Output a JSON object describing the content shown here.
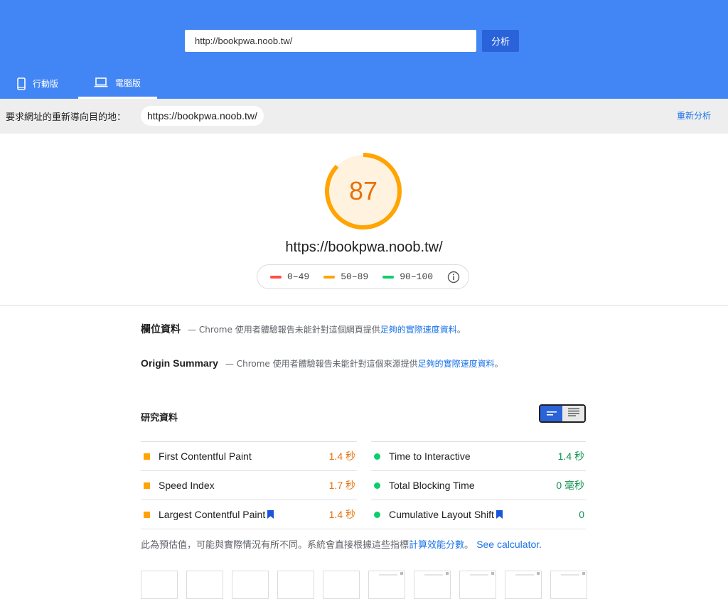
{
  "search": {
    "value": "http://bookpwa.noob.tw/",
    "button_label": "分析"
  },
  "tabs": [
    {
      "label": "行動版",
      "icon": "smartphone-icon",
      "active": false
    },
    {
      "label": "電腦版",
      "icon": "laptop-icon",
      "active": true
    }
  ],
  "redirect": {
    "label": "要求網址的重新導向目的地：",
    "url": "https://bookpwa.noob.tw/",
    "reanalyze_label": "重新分析"
  },
  "score": {
    "value": "87",
    "fraction": 0.87,
    "url": "https://bookpwa.noob.tw/",
    "legend": [
      {
        "range": "0–49",
        "color": "#ff4e42"
      },
      {
        "range": "50–89",
        "color": "#ffa400"
      },
      {
        "range": "90–100",
        "color": "#0cce6b"
      }
    ]
  },
  "field_data": {
    "title": "欄位資料",
    "prefix": "— Chrome 使用者體驗報告未能針對這個網頁提供",
    "link": "足夠的實際速度資料",
    "suffix": "。"
  },
  "origin_summary": {
    "title": "Origin Summary",
    "prefix": "— Chrome 使用者體驗報告未能針對這個來源提供",
    "link": "足夠的實際速度資料",
    "suffix": "。"
  },
  "lab_data": {
    "title": "研究資料",
    "metrics": [
      {
        "name": "First Contentful Paint",
        "value": "1.4 秒",
        "status": "average"
      },
      {
        "name": "Time to Interactive",
        "value": "1.4 秒",
        "status": "pass"
      },
      {
        "name": "Speed Index",
        "value": "1.7 秒",
        "status": "average"
      },
      {
        "name": "Total Blocking Time",
        "value": "0 毫秒",
        "status": "pass"
      },
      {
        "name": "Largest Contentful Paint",
        "value": "1.4 秒",
        "status": "average"
      },
      {
        "name": "Cumulative Layout Shift",
        "value": "0",
        "status": "pass"
      }
    ]
  },
  "footnote": {
    "text": "此為預估值，可能與實際情況有所不同。系統會直接根據這些指標",
    "link": "計算效能分數",
    "suffix": "。",
    "calculator": "See calculator."
  },
  "colors": {
    "header": "#4285f4",
    "accent_orange": "#ffa400",
    "pass_green": "#0cce6b",
    "fail_red": "#ff4e42",
    "link_blue": "#1a73e8"
  }
}
